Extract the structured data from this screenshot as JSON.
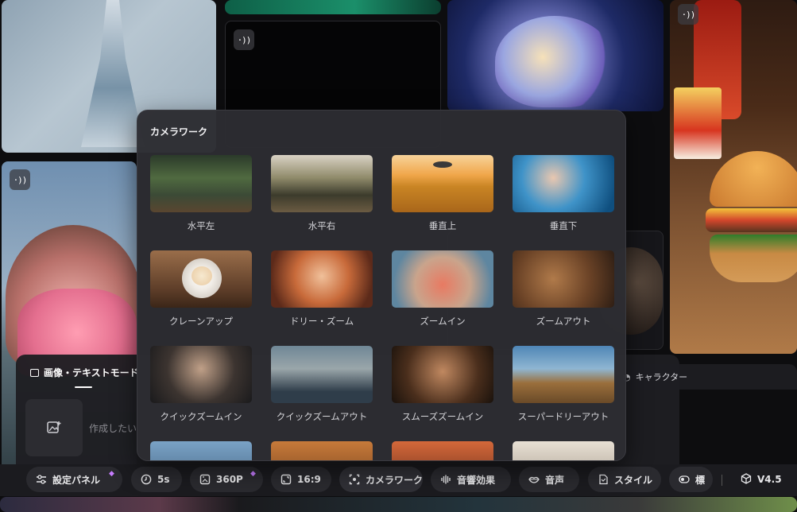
{
  "popup": {
    "title": "カメラワーク",
    "items": [
      {
        "label": "水平左",
        "icon": "pan-left-thumbnail"
      },
      {
        "label": "水平右",
        "icon": "pan-right-thumbnail"
      },
      {
        "label": "垂直上",
        "icon": "tilt-up-thumbnail"
      },
      {
        "label": "垂直下",
        "icon": "tilt-down-thumbnail"
      },
      {
        "label": "クレーンアップ",
        "icon": "crane-up-thumbnail"
      },
      {
        "label": "ドリー・ズーム",
        "icon": "dolly-zoom-thumbnail"
      },
      {
        "label": "ズームイン",
        "icon": "zoom-in-thumbnail"
      },
      {
        "label": "ズームアウト",
        "icon": "zoom-out-thumbnail"
      },
      {
        "label": "クイックズームイン",
        "icon": "quick-zoom-in-thumbnail"
      },
      {
        "label": "クイックズームアウト",
        "icon": "quick-zoom-out-thumbnail"
      },
      {
        "label": "スムーズズームイン",
        "icon": "smooth-zoom-in-thumbnail"
      },
      {
        "label": "スーパードリーアウト",
        "icon": "super-dolly-out-thumbnail"
      },
      {
        "label": "",
        "icon": "more-thumbnail"
      },
      {
        "label": "",
        "icon": "more-thumbnail"
      },
      {
        "label": "",
        "icon": "more-thumbnail"
      },
      {
        "label": "",
        "icon": "more-thumbnail"
      }
    ]
  },
  "mode": {
    "tab_label": "画像・テキストモード",
    "prompt_placeholder": "作成したい",
    "character_tab": "キャラクター"
  },
  "toolbar": {
    "settings_label": "設定パネル",
    "duration_label": "5s",
    "resolution_label": "360P",
    "aspect_label": "16:9",
    "camera_label": "カメラワーク",
    "sfx_label": "音響効果",
    "voice_label": "音声",
    "style_label": "スタイル",
    "extra_label": "標",
    "version_label": "V4.5"
  },
  "colors": {
    "popup_bg": "#2c2c32",
    "toolbar_bg": "#1b1b1f",
    "button_bg": "#2a2a2f",
    "premium_gem": "#c77dff"
  }
}
